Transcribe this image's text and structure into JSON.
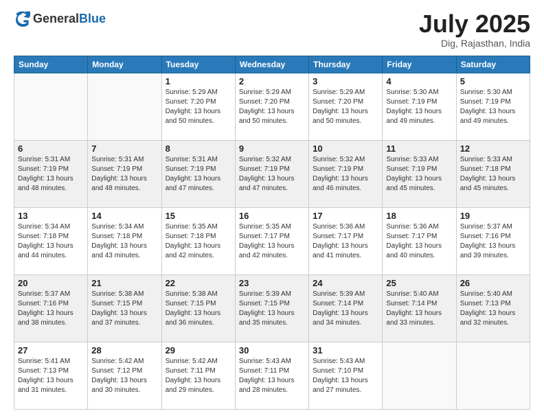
{
  "logo": {
    "general": "General",
    "blue": "Blue"
  },
  "title": "July 2025",
  "location": "Dig, Rajasthan, India",
  "weekdays": [
    "Sunday",
    "Monday",
    "Tuesday",
    "Wednesday",
    "Thursday",
    "Friday",
    "Saturday"
  ],
  "weeks": [
    [
      {
        "day": "",
        "info": ""
      },
      {
        "day": "",
        "info": ""
      },
      {
        "day": "1",
        "sunrise": "Sunrise: 5:29 AM",
        "sunset": "Sunset: 7:20 PM",
        "daylight": "Daylight: 13 hours and 50 minutes."
      },
      {
        "day": "2",
        "sunrise": "Sunrise: 5:29 AM",
        "sunset": "Sunset: 7:20 PM",
        "daylight": "Daylight: 13 hours and 50 minutes."
      },
      {
        "day": "3",
        "sunrise": "Sunrise: 5:29 AM",
        "sunset": "Sunset: 7:20 PM",
        "daylight": "Daylight: 13 hours and 50 minutes."
      },
      {
        "day": "4",
        "sunrise": "Sunrise: 5:30 AM",
        "sunset": "Sunset: 7:19 PM",
        "daylight": "Daylight: 13 hours and 49 minutes."
      },
      {
        "day": "5",
        "sunrise": "Sunrise: 5:30 AM",
        "sunset": "Sunset: 7:19 PM",
        "daylight": "Daylight: 13 hours and 49 minutes."
      }
    ],
    [
      {
        "day": "6",
        "sunrise": "Sunrise: 5:31 AM",
        "sunset": "Sunset: 7:19 PM",
        "daylight": "Daylight: 13 hours and 48 minutes."
      },
      {
        "day": "7",
        "sunrise": "Sunrise: 5:31 AM",
        "sunset": "Sunset: 7:19 PM",
        "daylight": "Daylight: 13 hours and 48 minutes."
      },
      {
        "day": "8",
        "sunrise": "Sunrise: 5:31 AM",
        "sunset": "Sunset: 7:19 PM",
        "daylight": "Daylight: 13 hours and 47 minutes."
      },
      {
        "day": "9",
        "sunrise": "Sunrise: 5:32 AM",
        "sunset": "Sunset: 7:19 PM",
        "daylight": "Daylight: 13 hours and 47 minutes."
      },
      {
        "day": "10",
        "sunrise": "Sunrise: 5:32 AM",
        "sunset": "Sunset: 7:19 PM",
        "daylight": "Daylight: 13 hours and 46 minutes."
      },
      {
        "day": "11",
        "sunrise": "Sunrise: 5:33 AM",
        "sunset": "Sunset: 7:19 PM",
        "daylight": "Daylight: 13 hours and 45 minutes."
      },
      {
        "day": "12",
        "sunrise": "Sunrise: 5:33 AM",
        "sunset": "Sunset: 7:18 PM",
        "daylight": "Daylight: 13 hours and 45 minutes."
      }
    ],
    [
      {
        "day": "13",
        "sunrise": "Sunrise: 5:34 AM",
        "sunset": "Sunset: 7:18 PM",
        "daylight": "Daylight: 13 hours and 44 minutes."
      },
      {
        "day": "14",
        "sunrise": "Sunrise: 5:34 AM",
        "sunset": "Sunset: 7:18 PM",
        "daylight": "Daylight: 13 hours and 43 minutes."
      },
      {
        "day": "15",
        "sunrise": "Sunrise: 5:35 AM",
        "sunset": "Sunset: 7:18 PM",
        "daylight": "Daylight: 13 hours and 42 minutes."
      },
      {
        "day": "16",
        "sunrise": "Sunrise: 5:35 AM",
        "sunset": "Sunset: 7:17 PM",
        "daylight": "Daylight: 13 hours and 42 minutes."
      },
      {
        "day": "17",
        "sunrise": "Sunrise: 5:36 AM",
        "sunset": "Sunset: 7:17 PM",
        "daylight": "Daylight: 13 hours and 41 minutes."
      },
      {
        "day": "18",
        "sunrise": "Sunrise: 5:36 AM",
        "sunset": "Sunset: 7:17 PM",
        "daylight": "Daylight: 13 hours and 40 minutes."
      },
      {
        "day": "19",
        "sunrise": "Sunrise: 5:37 AM",
        "sunset": "Sunset: 7:16 PM",
        "daylight": "Daylight: 13 hours and 39 minutes."
      }
    ],
    [
      {
        "day": "20",
        "sunrise": "Sunrise: 5:37 AM",
        "sunset": "Sunset: 7:16 PM",
        "daylight": "Daylight: 13 hours and 38 minutes."
      },
      {
        "day": "21",
        "sunrise": "Sunrise: 5:38 AM",
        "sunset": "Sunset: 7:15 PM",
        "daylight": "Daylight: 13 hours and 37 minutes."
      },
      {
        "day": "22",
        "sunrise": "Sunrise: 5:38 AM",
        "sunset": "Sunset: 7:15 PM",
        "daylight": "Daylight: 13 hours and 36 minutes."
      },
      {
        "day": "23",
        "sunrise": "Sunrise: 5:39 AM",
        "sunset": "Sunset: 7:15 PM",
        "daylight": "Daylight: 13 hours and 35 minutes."
      },
      {
        "day": "24",
        "sunrise": "Sunrise: 5:39 AM",
        "sunset": "Sunset: 7:14 PM",
        "daylight": "Daylight: 13 hours and 34 minutes."
      },
      {
        "day": "25",
        "sunrise": "Sunrise: 5:40 AM",
        "sunset": "Sunset: 7:14 PM",
        "daylight": "Daylight: 13 hours and 33 minutes."
      },
      {
        "day": "26",
        "sunrise": "Sunrise: 5:40 AM",
        "sunset": "Sunset: 7:13 PM",
        "daylight": "Daylight: 13 hours and 32 minutes."
      }
    ],
    [
      {
        "day": "27",
        "sunrise": "Sunrise: 5:41 AM",
        "sunset": "Sunset: 7:13 PM",
        "daylight": "Daylight: 13 hours and 31 minutes."
      },
      {
        "day": "28",
        "sunrise": "Sunrise: 5:42 AM",
        "sunset": "Sunset: 7:12 PM",
        "daylight": "Daylight: 13 hours and 30 minutes."
      },
      {
        "day": "29",
        "sunrise": "Sunrise: 5:42 AM",
        "sunset": "Sunset: 7:11 PM",
        "daylight": "Daylight: 13 hours and 29 minutes."
      },
      {
        "day": "30",
        "sunrise": "Sunrise: 5:43 AM",
        "sunset": "Sunset: 7:11 PM",
        "daylight": "Daylight: 13 hours and 28 minutes."
      },
      {
        "day": "31",
        "sunrise": "Sunrise: 5:43 AM",
        "sunset": "Sunset: 7:10 PM",
        "daylight": "Daylight: 13 hours and 27 minutes."
      },
      {
        "day": "",
        "info": ""
      },
      {
        "day": "",
        "info": ""
      }
    ]
  ]
}
